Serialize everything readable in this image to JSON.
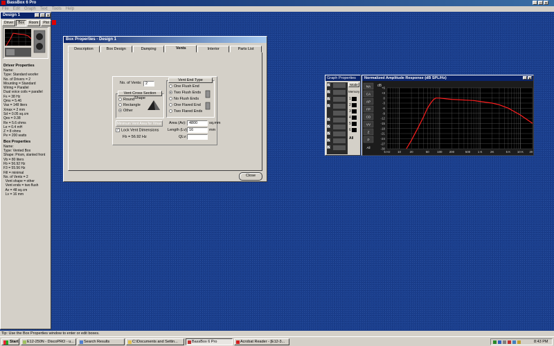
{
  "app": {
    "title": "BassBox 6 Pro"
  },
  "menu": [
    "File",
    "Edit",
    "Graph",
    "Text",
    "Tools",
    "Help"
  ],
  "design_window": {
    "title": "Design 1",
    "buttons": [
      "Driver",
      "Box",
      "Room",
      "Plot"
    ],
    "driver_properties_title": "Driver Properties",
    "driver_properties": [
      "Name:",
      "Type: Standard woofer",
      "No. of Drivers = 2",
      "Mounting = Standard",
      "Wiring = Parallel",
      "Dual voice coils = parallel",
      "Fs = 38 Hz",
      "Qms = 5.46",
      "Vas = 148 liters",
      "Xmax = 2 mm",
      "Sd = 0.05 sq.cm",
      "Qes = 0.38",
      "Re = 5.6 ohms",
      "Le = 0.4 mH",
      "Z = 8 ohms",
      "Pe = 200 watts"
    ],
    "box_properties_title": "Box Properties",
    "box_properties": [
      "Name:",
      "Type: Vented Box",
      "Shape: Prism, slanted front",
      "Vb = 80 liters",
      "Fb = 56.92 Hz",
      "F3 = 55.56 Hz",
      "Fill = minimal",
      "No. of Vents = 2",
      "  Vent shape = other",
      "  Vent ends = two flush",
      "  Av = 48 sq.cm",
      "  Lv = 16 mm"
    ]
  },
  "box_dialog": {
    "title": "Box Properties - Design 1",
    "tabs": [
      "Description",
      "Box Design",
      "Damping",
      "Vents",
      "Interior",
      "Parts List"
    ],
    "active_tab": "Vents",
    "num_vents_label": "No. of Vents:",
    "num_vents_value": "2",
    "cross_section_title": "Vent Cross Section Shape",
    "shapes": [
      "Round",
      "Rectangle",
      "Other"
    ],
    "shape_selected": "Other",
    "end_type_title": "Vent End Type",
    "end_types": [
      "One Flush End",
      "Two Flush Ends",
      "No Flush Ends",
      "One Flared End",
      "Two Flared Ends"
    ],
    "end_selected": "Two Flush Ends",
    "minimum_button": "Minimum Vent Area for Xmax",
    "area_label": "Area (Av):",
    "area_value": "4800",
    "area_unit": "sq.mm",
    "length_label": "Length (Lv):",
    "length_value": "16",
    "length_unit": "mm",
    "qlv_label": "QLv:",
    "qlv_value": "",
    "lock_label": "Lock Vent Dimensions",
    "fb_text": "Fb = 56.92 Hz",
    "close_button": "Close"
  },
  "graph_properties": {
    "title": "Graph Properties",
    "mode_button": "Mode",
    "memory_label": "Memory",
    "letters": [
      "NA",
      "CA",
      "AP",
      "FP",
      "CD",
      "VV",
      "Z",
      "P",
      "All"
    ],
    "memory_slots": [
      "1",
      "2",
      "3",
      "4",
      "5",
      "6"
    ]
  },
  "graph_window": {
    "title": "Normalized Amplitude Response (dB SPL/Hz)",
    "y_unit": "dB",
    "y_ticks": [
      "+6",
      "+3",
      "0",
      "-3",
      "-6",
      "-9",
      "-12",
      "-15",
      "-18",
      "-21",
      "-24",
      "-27",
      "-30"
    ],
    "x_ticks": [
      "5 Hz",
      "10",
      "20",
      "50",
      "100",
      "200",
      "500",
      "1 K",
      "2K",
      "5 K",
      "10 K",
      "20 K"
    ]
  },
  "chart_data": {
    "type": "line",
    "title": "Normalized Amplitude Response (dB SPL/Hz)",
    "xlabel": "",
    "ylabel": "dB",
    "xscale": "log",
    "xlim": [
      5,
      20000
    ],
    "ylim": [
      -30,
      6
    ],
    "grid": true,
    "series": [
      {
        "color": "#ff1e1e",
        "x": [
          15,
          20,
          30,
          40,
          50,
          60,
          70,
          80,
          100,
          150,
          200,
          300,
          500,
          700,
          1000,
          2000,
          3000,
          5000,
          10000,
          20000
        ],
        "y": [
          -30,
          -25,
          -17,
          -11,
          -6,
          -3,
          -1,
          0,
          0,
          -0.5,
          -0.8,
          -1.0,
          -1.3,
          -1.5,
          -2,
          -3,
          -4,
          -6,
          -10,
          -15
        ]
      }
    ],
    "line_color": "#ff1e1e",
    "background": "#000000",
    "grid_color": "#6a6a6a"
  },
  "status_bar": {
    "text": "Tip: Use the Box Properties window to enter or edit boxes."
  },
  "taskbar": {
    "start": "Start",
    "tasks": [
      "E12-250N - DiscoPRO - u...",
      "Search Results",
      "C:\\Documents and Settin...",
      "BassBox 6 Pro",
      "Acrobat Reader - [E12-3..."
    ],
    "active_task": "BassBox 6 Pro",
    "clock": "8:43 PM"
  }
}
